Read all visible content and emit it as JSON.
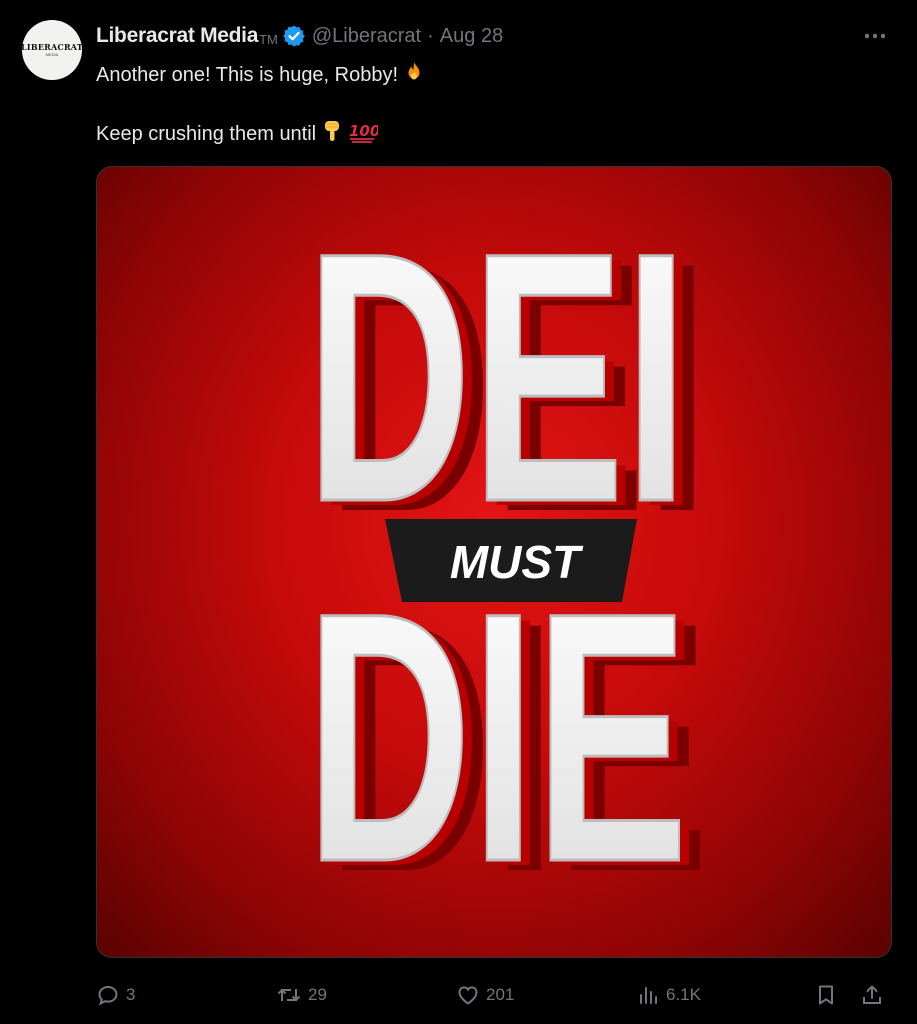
{
  "author": {
    "display_name": "Liberacrat Media",
    "tm_mark": "TM",
    "handle": "@Liberacrat",
    "separator": "·",
    "date": "Aug 28",
    "avatar_text": "LIBERACRAT",
    "avatar_sub": "MEDIA",
    "verified_color": "#1d9bf0"
  },
  "tweet": {
    "line1": "Another one! This is huge, Robby!",
    "line2": "Keep crushing them until"
  },
  "media": {
    "top_word": "DEI",
    "banner_word": "MUST",
    "bottom_word": "DIE",
    "background_color": "#d40e0e"
  },
  "actions": {
    "replies": "3",
    "reposts": "29",
    "likes": "201",
    "views": "6.1K"
  },
  "icons": {
    "more": "more-horizontal-icon",
    "reply": "reply-icon",
    "repost": "repost-icon",
    "like": "heart-icon",
    "views": "views-bar-chart-icon",
    "bookmark": "bookmark-icon",
    "share": "share-icon",
    "verified": "verified-badge-icon"
  }
}
